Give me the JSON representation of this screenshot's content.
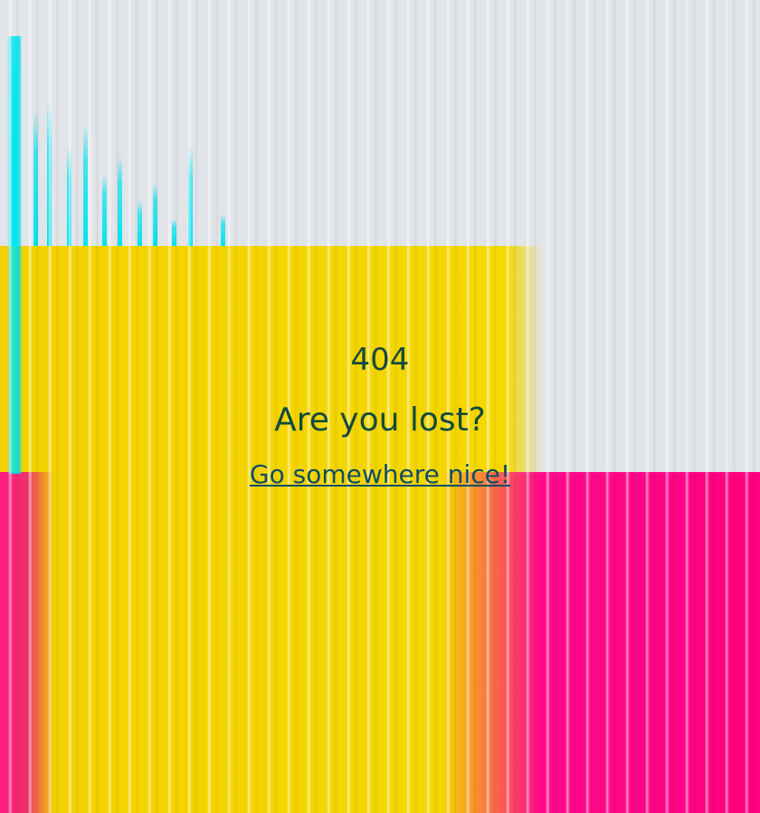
{
  "error": {
    "code": "404",
    "title": "Are you lost?",
    "link_label": "Go somewhere nice!"
  },
  "colors": {
    "text": "#134a3f",
    "link": "#0d4e69",
    "yellow": "#f2d100",
    "magenta": "#ff0080",
    "cyan": "#00e5ef",
    "grey": "#e1e4e9"
  }
}
